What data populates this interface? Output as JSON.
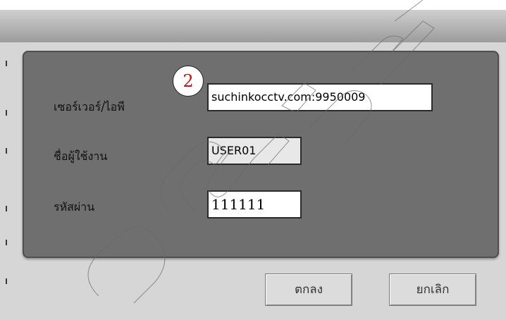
{
  "dialog": {
    "fields": [
      {
        "label": "เซอร์เวอร์/ไอพี",
        "value": "suchinkocctv.com:9950009"
      },
      {
        "label": "ชื่อผู้ใช้งาน",
        "value": "USER01"
      },
      {
        "label": "รหัสผ่าน",
        "value": "111111"
      }
    ],
    "callout_number": "2",
    "ok_label": "ตกลง",
    "cancel_label": "ยกเลิก"
  },
  "colors": {
    "panel": "#6f6f6f",
    "window": "#d6d6d6",
    "callout_text": "#d01010"
  }
}
